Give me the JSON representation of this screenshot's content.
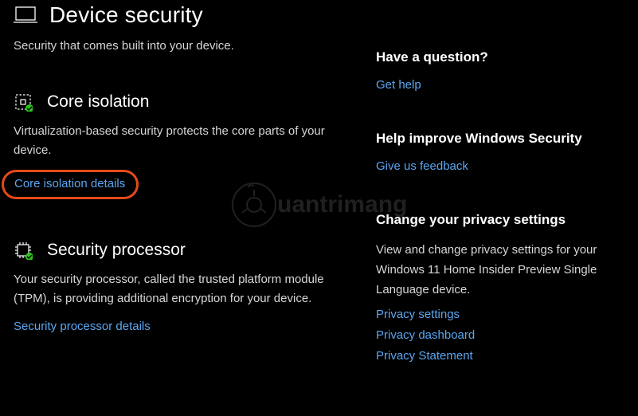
{
  "header": {
    "title": "Device security",
    "subtitle": "Security that comes built into your device."
  },
  "sections": {
    "core_isolation": {
      "title": "Core isolation",
      "desc": "Virtualization-based security protects the core parts of your device.",
      "link": "Core isolation details"
    },
    "security_processor": {
      "title": "Security processor",
      "desc": "Your security processor, called the trusted platform module (TPM), is providing additional encryption for your device.",
      "link": "Security processor details"
    }
  },
  "side": {
    "question": {
      "title": "Have a question?",
      "link": "Get help"
    },
    "improve": {
      "title": "Help improve Windows Security",
      "link": "Give us feedback"
    },
    "privacy": {
      "title": "Change your privacy settings",
      "desc": "View and change privacy settings for your Windows 11 Home Insider Preview Single Language device.",
      "links": {
        "settings": "Privacy settings",
        "dashboard": "Privacy dashboard",
        "statement": "Privacy Statement"
      }
    }
  },
  "watermark": "uantrimang"
}
